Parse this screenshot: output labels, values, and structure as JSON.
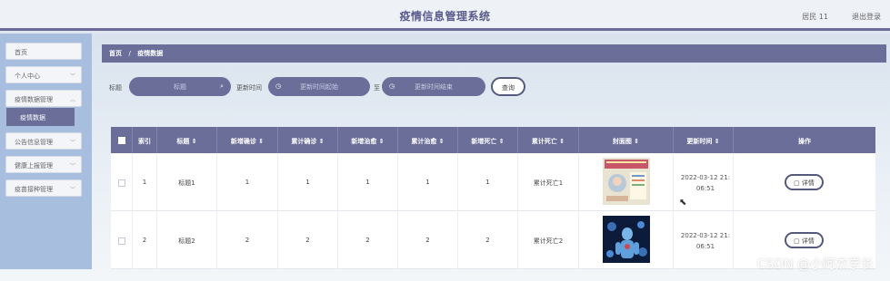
{
  "header": {
    "title": "疫情信息管理系统",
    "user": "居民 11",
    "logout": "退出登录"
  },
  "sidebar": {
    "items": [
      {
        "label": "首页",
        "chevron": false
      },
      {
        "label": "个人中心",
        "chevron": true
      },
      {
        "label": "疫情数据管理",
        "chevron": true
      },
      {
        "label": "公告信息管理",
        "chevron": true
      },
      {
        "label": "健康上报管理",
        "chevron": true
      },
      {
        "label": "疫苗接种管理",
        "chevron": true
      }
    ],
    "active_sub": "疫情数据"
  },
  "breadcrumb": {
    "home": "首页",
    "separator": "/",
    "current": "疫情数据"
  },
  "search": {
    "title_label": "标题",
    "title_placeholder": "标题",
    "time_label": "更新时间",
    "start_placeholder": "更新时间起始",
    "to_label": "至",
    "end_placeholder": "更新时间结束",
    "query_button": "查询"
  },
  "table": {
    "columns": [
      "",
      "索引",
      "标题 ⇕",
      "新增确诊 ⇕",
      "累计确诊 ⇕",
      "新增治愈 ⇕",
      "累计治愈 ⇕",
      "新增死亡 ⇕",
      "累计死亡 ⇕",
      "封面图 ⇕",
      "更新时间 ⇕",
      "操作"
    ],
    "rows": [
      {
        "index": "1",
        "title": "标题1",
        "new_confirmed": "1",
        "total_confirmed": "1",
        "new_cured": "1",
        "total_cured": "1",
        "new_deaths": "1",
        "total_deaths": "累计死亡1",
        "updated_line1": "2022-03-12 21:",
        "updated_line2": "06:51",
        "action": "详情",
        "cover": "poster"
      },
      {
        "index": "2",
        "title": "标题2",
        "new_confirmed": "2",
        "total_confirmed": "2",
        "new_cured": "2",
        "total_cured": "2",
        "new_deaths": "2",
        "total_deaths": "累计死亡2",
        "updated_line1": "2022-03-12 21:",
        "updated_line2": "06:51",
        "action": "详情",
        "cover": "virus"
      }
    ]
  },
  "watermark": "CSDN @小阿杰学长",
  "colors": {
    "accent": "#6c6e9a",
    "sidebar": "#a7bedf",
    "header_bg": "#eef1f6"
  }
}
